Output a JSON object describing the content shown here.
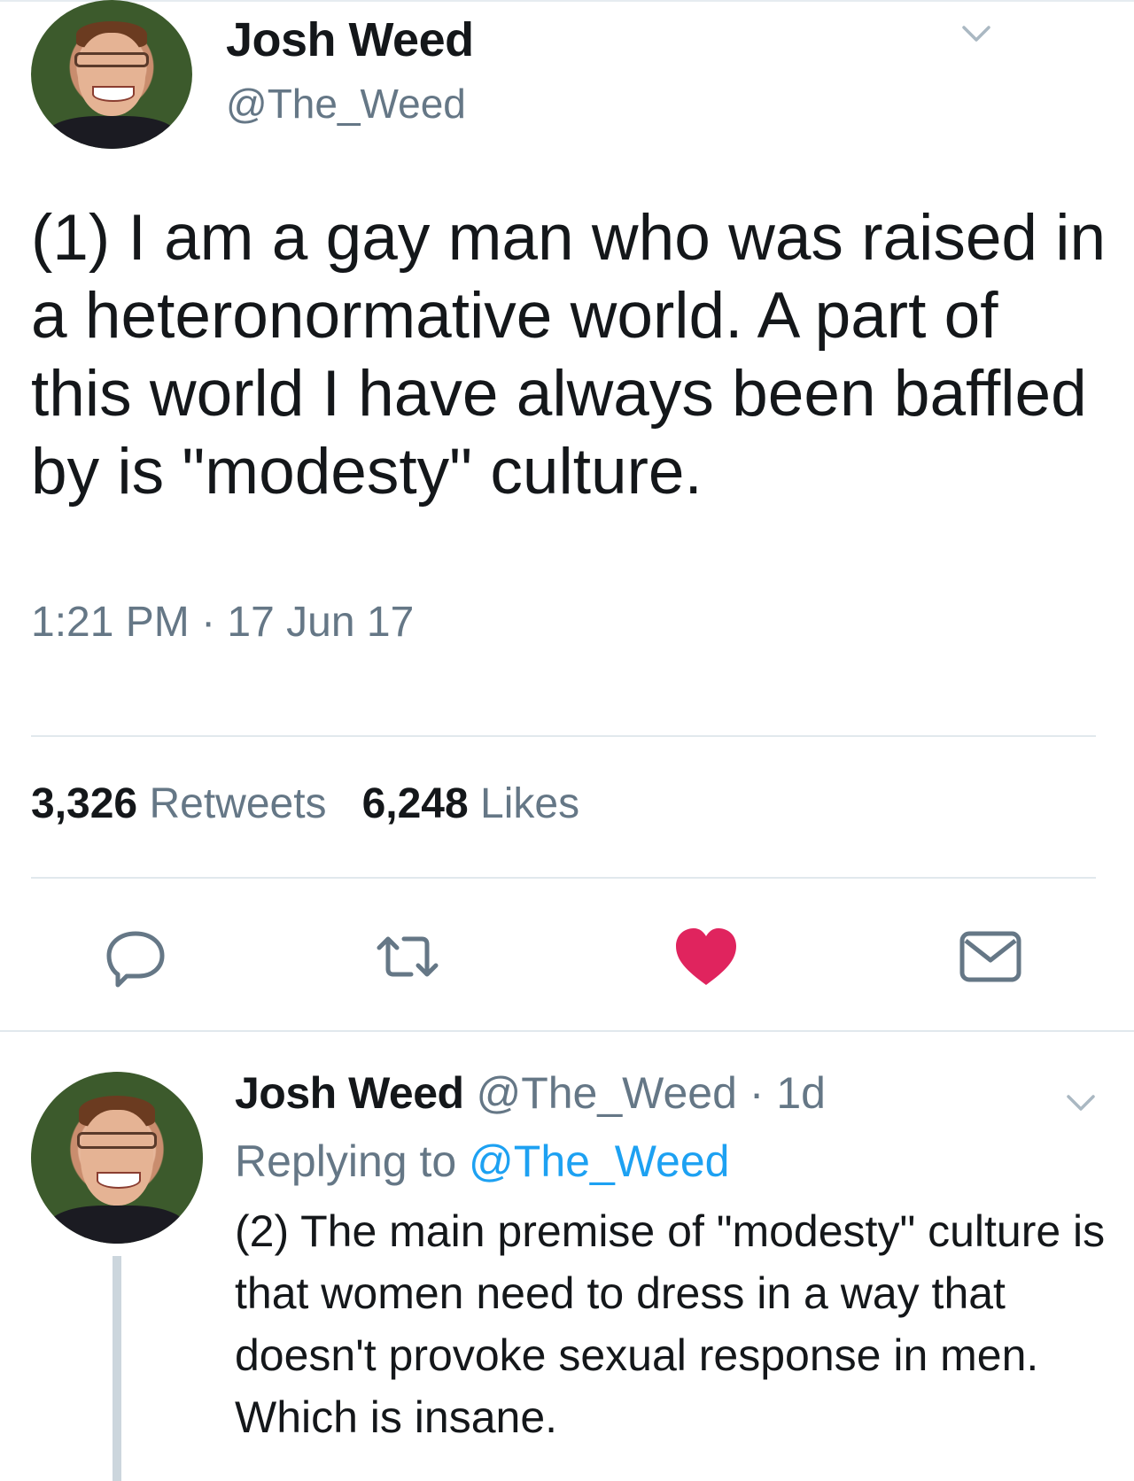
{
  "main_tweet": {
    "display_name": "Josh Weed",
    "handle": "@The_Weed",
    "text": "(1) I am a gay man who was raised in a heteronormative world. A part of this world I have always been baffled by is \"modesty\" culture.",
    "timestamp": "1:21 PM · 17 Jun 17",
    "retweets_count": "3,326",
    "retweets_label": "Retweets",
    "likes_count": "6,248",
    "likes_label": "Likes",
    "liked": true,
    "colors": {
      "like_active": "#e0245e",
      "icon_gray": "#657786",
      "link_blue": "#1da1f2"
    },
    "icons": [
      "reply-icon",
      "retweet-icon",
      "like-icon",
      "direct-message-icon",
      "chevron-down-icon"
    ]
  },
  "reply_tweet": {
    "display_name": "Josh Weed",
    "handle": "@The_Weed",
    "separator": " · ",
    "time": "1d",
    "replying_prefix": "Replying to ",
    "replying_to": "@The_Weed",
    "text": "(2) The main premise of \"modesty\" culture is that women need to dress in a way that doesn't provoke sexual response in men. Which is insane."
  }
}
